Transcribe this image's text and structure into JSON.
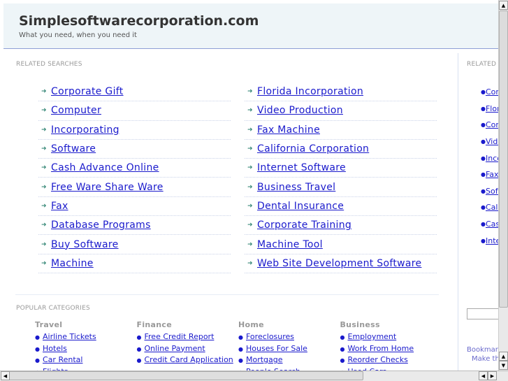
{
  "header": {
    "title": "Simplesoftwarecorporation.com",
    "tagline": "What you need, when you need it"
  },
  "related_searches": {
    "label": "RELATED SEARCHES",
    "left": [
      "Corporate Gift",
      "Computer",
      "Incorporating",
      "Software",
      "Cash Advance Online",
      "Free Ware Share Ware",
      "Fax",
      "Database Programs",
      "Buy Software",
      "Machine"
    ],
    "right": [
      "Florida Incorporation",
      "Video Production",
      "Fax Machine",
      "California Corporation",
      "Internet Software",
      "Business Travel",
      "Dental Insurance",
      "Corporate Training",
      "Machine Tool",
      "Web Site Development Software"
    ]
  },
  "sidebar": {
    "label": "RELATED",
    "items": [
      "Corporate Gift",
      "Florida Incorporation",
      "Computer",
      "Video Production",
      "Incorporating",
      "Fax Machine",
      "Software",
      "California Corporation",
      "Cash Advance",
      "Internet Software"
    ],
    "bookmark": "Bookmark",
    "make": "Make this"
  },
  "popular": {
    "label": "POPULAR CATEGORIES",
    "categories": [
      {
        "title": "Travel",
        "items": [
          "Airline Tickets",
          "Hotels",
          "Car Rental",
          "Flights"
        ]
      },
      {
        "title": "Finance",
        "items": [
          "Free Credit Report",
          "Online Payment",
          "Credit Card Application"
        ]
      },
      {
        "title": "Home",
        "items": [
          "Foreclosures",
          "Houses For Sale",
          "Mortgage",
          "People Search"
        ]
      },
      {
        "title": "Business",
        "items": [
          "Employment",
          "Work From Home",
          "Reorder Checks",
          "Used Cars"
        ]
      }
    ]
  }
}
